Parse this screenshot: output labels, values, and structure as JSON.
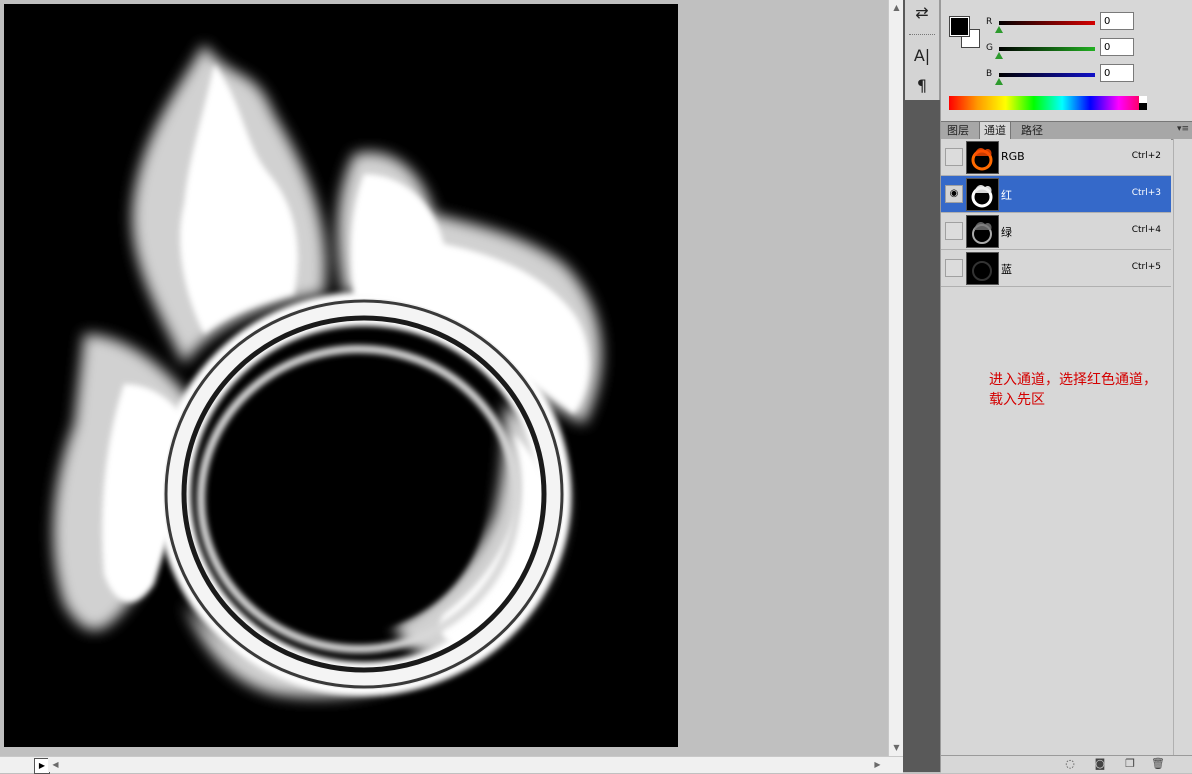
{
  "color_panel": {
    "channels": [
      {
        "label": "R",
        "value": "0",
        "track": "#d40000"
      },
      {
        "label": "G",
        "value": "0",
        "track": "#22b022"
      },
      {
        "label": "B",
        "value": "0",
        "track": "#1010c8"
      }
    ]
  },
  "panel_tabs": [
    "图层",
    "通道",
    "路径"
  ],
  "active_tab": "通道",
  "channels": [
    {
      "name": "RGB",
      "shortcut": "Ctrl+2",
      "visible": false,
      "selected": false
    },
    {
      "name": "红",
      "shortcut": "Ctrl+3",
      "visible": true,
      "selected": true
    },
    {
      "name": "绿",
      "shortcut": "Ctrl+4",
      "visible": false,
      "selected": false
    },
    {
      "name": "蓝",
      "shortcut": "Ctrl+5",
      "visible": false,
      "selected": false
    }
  ],
  "annotation": {
    "line1": "进入通道，选择红色通道，",
    "line2": "载入先区"
  },
  "icons": {
    "dock": [
      "history-icon",
      "character-icon",
      "paragraph-icon"
    ],
    "bottom": [
      "load-selection-icon",
      "save-selection-icon",
      "new-channel-icon",
      "delete-icon"
    ]
  },
  "colors": {
    "selected_row": "#3569c9",
    "annotation_text": "#d40000"
  }
}
